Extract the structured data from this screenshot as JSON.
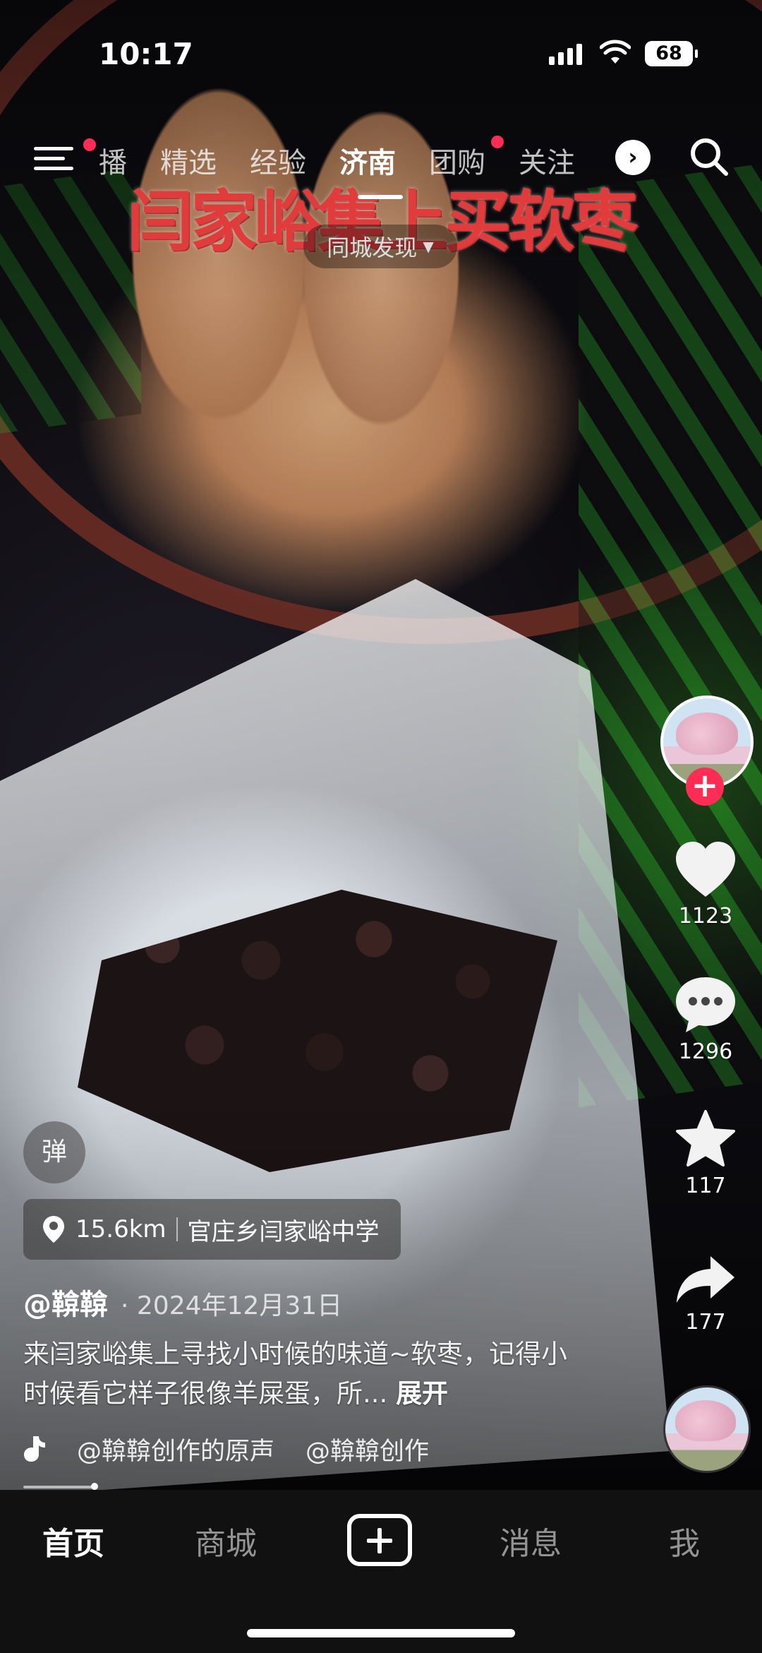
{
  "status_bar": {
    "time": "10:17",
    "battery": "68"
  },
  "top_nav": {
    "tabs": [
      "播",
      "精选",
      "经验",
      "济南",
      "团购",
      "关注"
    ],
    "active_tab": "济南",
    "city_filter": "同城发现"
  },
  "video": {
    "overlay_title": "闫家峪集上买软枣"
  },
  "actions": {
    "likes": "1123",
    "comments": "1296",
    "favorites": "117",
    "shares": "177"
  },
  "post": {
    "danmu_label": "弹",
    "distance": "15.6km",
    "location_name": "官庄乡闫家峪中学",
    "author": "@鞥鞥",
    "date": "· 2024年12月31日",
    "description": "来闫家峪集上寻找小时候的味道~软枣，记得小时候看它样子很像羊屎蛋，所...",
    "expand_label": "展开",
    "music": [
      "@鞥鞥创作的原声",
      "@鞥鞥创作"
    ]
  },
  "bottom_tabs": {
    "home": "首页",
    "mall": "商城",
    "messages": "消息",
    "me": "我"
  },
  "colors": {
    "accent": "#ff2d55",
    "title_red": "#e23b3b",
    "tabbar_bg": "#111111"
  },
  "icons": [
    "menu-icon",
    "search-icon",
    "chevron-right-icon",
    "location-pin-icon",
    "heart-icon",
    "comment-icon",
    "star-icon",
    "share-icon",
    "music-note-icon",
    "plus-icon"
  ]
}
